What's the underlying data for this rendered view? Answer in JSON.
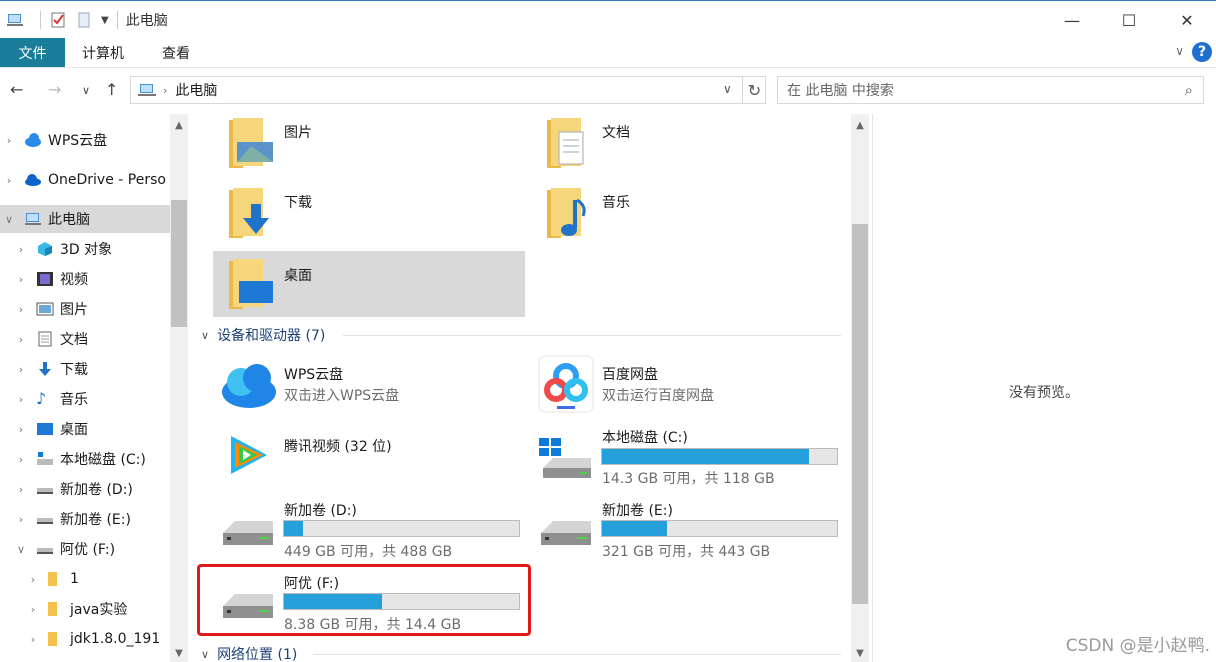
{
  "window": {
    "title": "此电脑"
  },
  "ribbon": {
    "tabs": [
      "文件",
      "计算机",
      "查看"
    ]
  },
  "address": {
    "path": "此电脑",
    "search_placeholder": "在 此电脑 中搜索"
  },
  "sidebar": {
    "items": [
      {
        "label": "WPS云盘",
        "icon": "wps-cloud-icon"
      },
      {
        "label": "OneDrive - Perso",
        "icon": "onedrive-icon"
      },
      {
        "label": "此电脑",
        "icon": "computer-icon",
        "selected": true
      },
      {
        "label": "3D 对象",
        "icon": "3d-objects-icon"
      },
      {
        "label": "视频",
        "icon": "video-icon"
      },
      {
        "label": "图片",
        "icon": "pictures-icon"
      },
      {
        "label": "文档",
        "icon": "documents-icon"
      },
      {
        "label": "下载",
        "icon": "download-icon"
      },
      {
        "label": "音乐",
        "icon": "music-icon"
      },
      {
        "label": "桌面",
        "icon": "desktop-icon"
      },
      {
        "label": "本地磁盘 (C:)",
        "icon": "system-drive-icon"
      },
      {
        "label": "新加卷 (D:)",
        "icon": "drive-icon"
      },
      {
        "label": "新加卷 (E:)",
        "icon": "drive-icon"
      },
      {
        "label": "阿优 (F:)",
        "icon": "drive-icon"
      },
      {
        "label": "1",
        "icon": "folder-icon"
      },
      {
        "label": "java实验",
        "icon": "folder-icon"
      },
      {
        "label": "jdk1.8.0_191",
        "icon": "folder-icon"
      }
    ]
  },
  "folders": [
    {
      "label": "图片",
      "icon": "pictures-folder-icon"
    },
    {
      "label": "文档",
      "icon": "documents-folder-icon"
    },
    {
      "label": "下载",
      "icon": "downloads-folder-icon"
    },
    {
      "label": "音乐",
      "icon": "music-folder-icon"
    },
    {
      "label": "桌面",
      "icon": "desktop-folder-icon"
    }
  ],
  "devices_header": "设备和驱动器 (7)",
  "devices": {
    "wps": {
      "label": "WPS云盘",
      "sub": "双击进入WPS云盘"
    },
    "baidu": {
      "label": "百度网盘",
      "sub": "双击运行百度网盘"
    },
    "tencent": {
      "label": "腾讯视频 (32 位)"
    },
    "c": {
      "label": "本地磁盘 (C:)",
      "sub": "14.3 GB 可用，共 118 GB",
      "used_fraction": 0.879
    },
    "d": {
      "label": "新加卷 (D:)",
      "sub": "449 GB 可用，共 488 GB",
      "used_fraction": 0.08
    },
    "e": {
      "label": "新加卷 (E:)",
      "sub": "321 GB 可用，共 443 GB",
      "used_fraction": 0.275
    },
    "f": {
      "label": "阿优 (F:)",
      "sub": "8.38 GB 可用，共 14.4 GB",
      "used_fraction": 0.418
    }
  },
  "network_header": "网络位置 (1)",
  "preview": {
    "text": "没有预览。"
  },
  "watermark": "CSDN @是小赵鸭."
}
